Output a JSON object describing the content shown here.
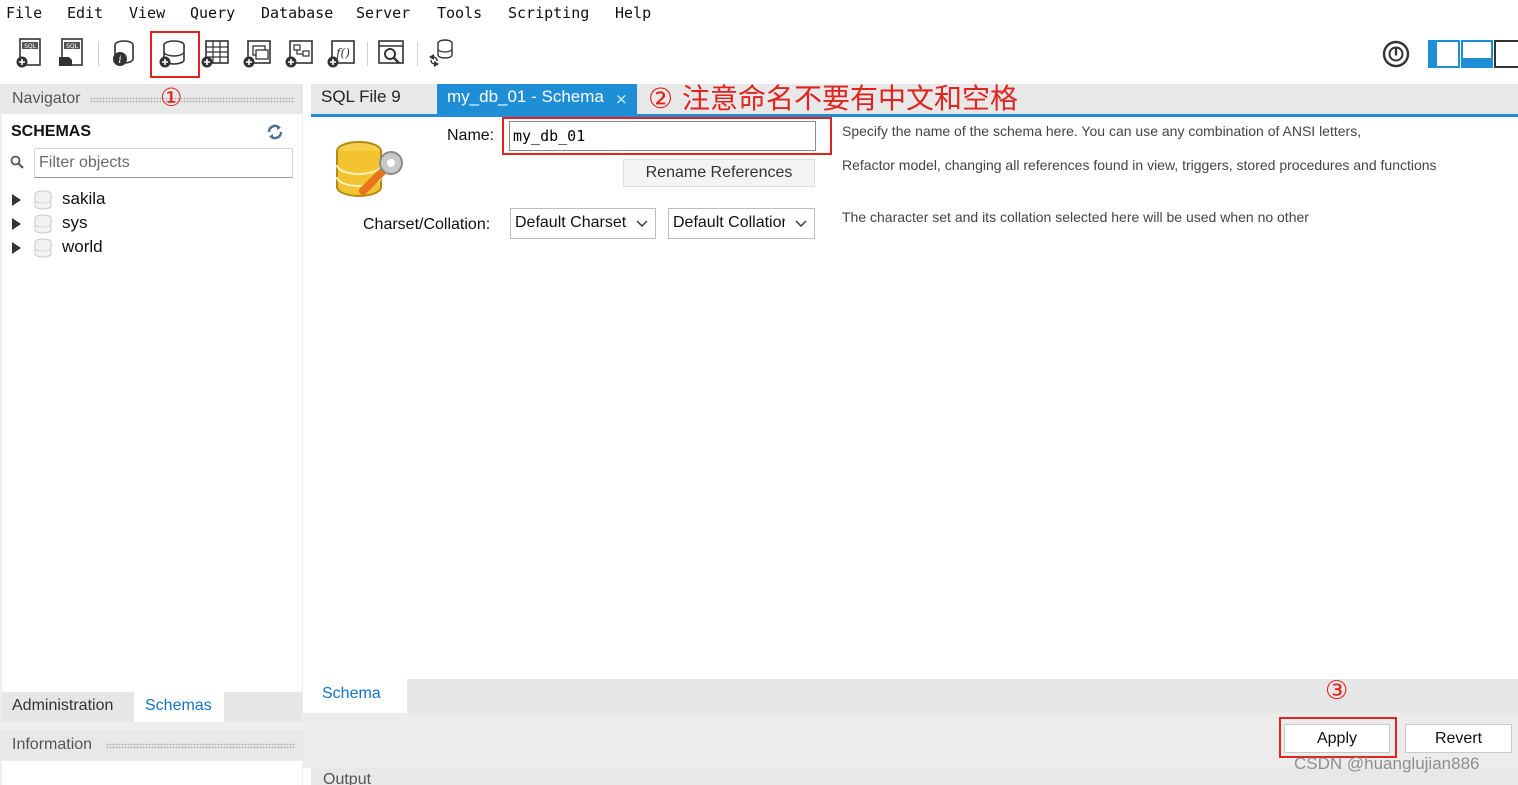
{
  "menu": [
    "File",
    "Edit",
    "View",
    "Query",
    "Database",
    "Server",
    "Tools",
    "Scripting",
    "Help"
  ],
  "toolbar_icons": [
    "new-sql-tab-icon",
    "open-sql-script-icon",
    "schema-inspector-icon",
    "create-schema-icon",
    "create-table-icon",
    "create-view-icon",
    "create-procedure-icon",
    "create-function-icon",
    "search-data-icon",
    "reconnect-icon"
  ],
  "navigator": {
    "title": "Navigator",
    "schemas_title": "SCHEMAS",
    "filter_placeholder": "Filter objects",
    "schemas": [
      "sakila",
      "sys",
      "world"
    ],
    "tabs": {
      "administration": "Administration",
      "schemas": "Schemas"
    },
    "information_title": "Information"
  },
  "tabs": {
    "sql_file": "SQL File 9",
    "schema": "my_db_01 - Schema",
    "close": "×"
  },
  "editor": {
    "name_label": "Name:",
    "name_value": "my_db_01",
    "name_desc": "Specify the name of the schema here. You can use any combination of ANSI letters,",
    "rename_button": "Rename References",
    "refactor_desc": "Refactor model, changing all references found in view, triggers, stored procedures and functions",
    "charset_label": "Charset/Collation:",
    "charset_value": "Default Charset",
    "collation_value": "Default Collation",
    "charset_desc": "The character set and its collation selected here will be used when no other"
  },
  "bottom_tab": "Schema",
  "buttons": {
    "apply": "Apply",
    "revert": "Revert"
  },
  "output_title": "Output",
  "annotations": {
    "step1": "①",
    "step2": "② 注意命名不要有中文和空格",
    "step3": "③"
  },
  "watermark": "CSDN @huanglujian886",
  "colors": {
    "accent": "#1e8fd6",
    "annotation": "#e0231f",
    "link": "#1672c4"
  }
}
